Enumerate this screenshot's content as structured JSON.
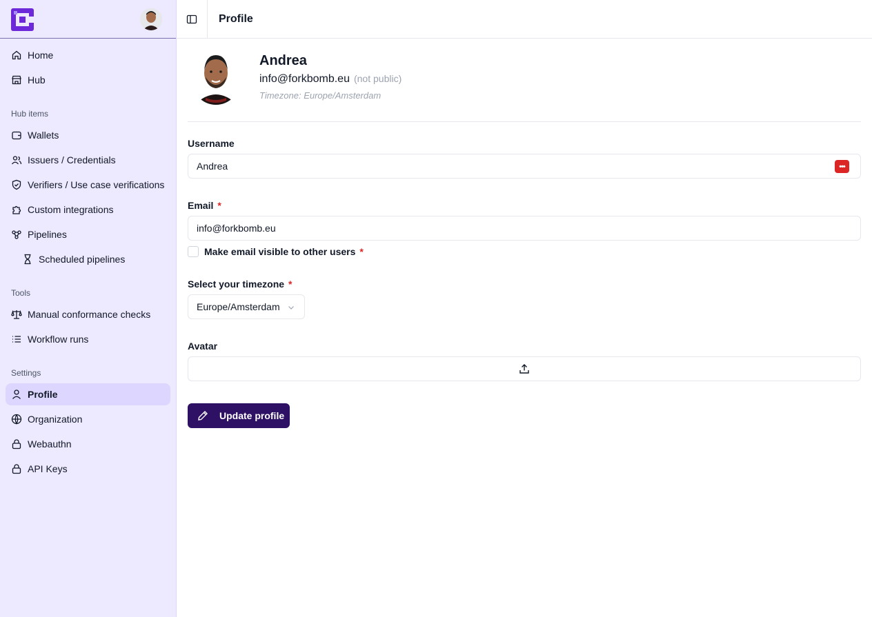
{
  "sidebar": {
    "logo_icon": "app-logo",
    "user_avatar_icon": "user-avatar",
    "primary": [
      {
        "label": "Home",
        "icon": "home-icon"
      },
      {
        "label": "Hub",
        "icon": "store-icon"
      }
    ],
    "groups": [
      {
        "label": "Hub items",
        "items": [
          {
            "label": "Wallets",
            "icon": "wallet-icon"
          },
          {
            "label": "Issuers / Credentials",
            "icon": "users-icon"
          },
          {
            "label": "Verifiers / Use case verifications",
            "icon": "shield-check-icon"
          },
          {
            "label": "Custom integrations",
            "icon": "puzzle-icon"
          },
          {
            "label": "Pipelines",
            "icon": "workflow-icon"
          },
          {
            "label": "Scheduled pipelines",
            "icon": "hourglass-icon"
          }
        ]
      },
      {
        "label": "Tools",
        "items": [
          {
            "label": "Manual conformance checks",
            "icon": "scale-icon"
          },
          {
            "label": "Workflow runs",
            "icon": "list-icon"
          }
        ]
      },
      {
        "label": "Settings",
        "items": [
          {
            "label": "Profile",
            "icon": "user-icon",
            "active": true
          },
          {
            "label": "Organization",
            "icon": "globe-icon"
          },
          {
            "label": "Webauthn",
            "icon": "lock-icon"
          },
          {
            "label": "API Keys",
            "icon": "lock-icon"
          }
        ]
      }
    ]
  },
  "topbar": {
    "toggle_icon": "sidebar-toggle-icon",
    "title": "Profile"
  },
  "profile": {
    "name": "Andrea",
    "email": "info@forkbomb.eu",
    "email_note": "(not public)",
    "timezone_text": "Timezone: Europe/Amsterdam"
  },
  "form": {
    "username_label": "Username",
    "username_value": "Andrea",
    "password_manager_icon": "password-manager-icon",
    "email_label": "Email",
    "required_mark": "*",
    "email_value": "info@forkbomb.eu",
    "email_visible_label": "Make email visible to other users",
    "timezone_label": "Select your timezone",
    "timezone_value": "Europe/Amsterdam",
    "avatar_label": "Avatar",
    "upload_icon": "upload-icon",
    "submit_label": "Update profile",
    "submit_icon": "pencil-icon"
  },
  "colors": {
    "sidebar_bg": "#ede9fe",
    "active_item_bg": "#ddd6fe",
    "primary_button": "#2e1065",
    "required": "#dc2626",
    "logo": "#6d28d9"
  }
}
